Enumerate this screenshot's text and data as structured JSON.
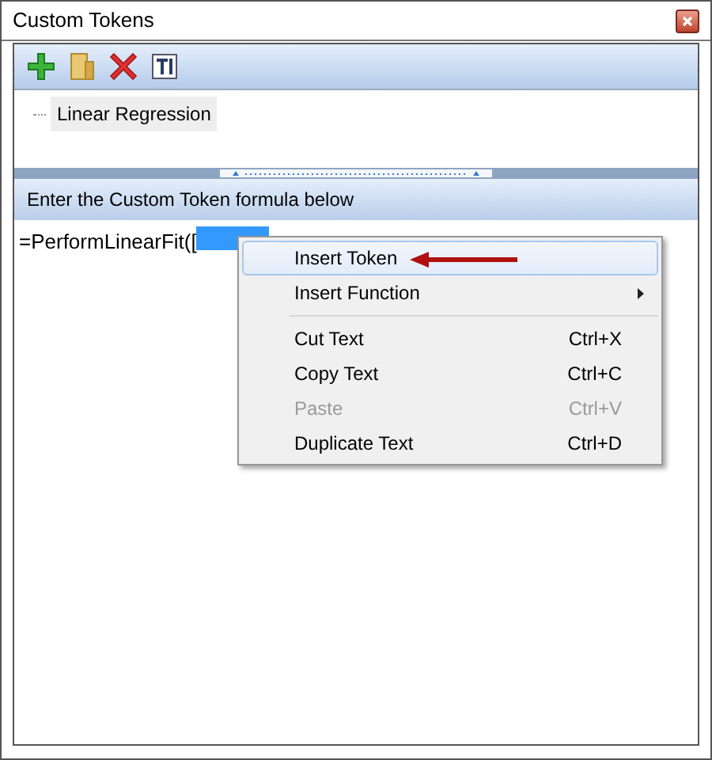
{
  "window": {
    "title": "Custom Tokens"
  },
  "toolbar": {
    "buttons": [
      {
        "kind": "add"
      },
      {
        "kind": "folder"
      },
      {
        "kind": "delete"
      },
      {
        "kind": "text"
      }
    ]
  },
  "tree": {
    "items": [
      {
        "label": "Linear Regression",
        "selected": true
      }
    ]
  },
  "formula_header": "Enter the Custom Token formula below",
  "formula": {
    "text": "=PerformLinearFit([",
    "has_selection": true
  },
  "context_menu": {
    "items": [
      {
        "kind": "item",
        "label": "Insert Token",
        "highlighted": true,
        "disabled": false,
        "arrow_annotation": true
      },
      {
        "kind": "submenu",
        "label": "Insert Function",
        "highlighted": false,
        "disabled": false
      },
      {
        "kind": "separator"
      },
      {
        "kind": "item",
        "label": "Cut Text",
        "shortcut": "Ctrl+X",
        "highlighted": false,
        "disabled": false
      },
      {
        "kind": "item",
        "label": "Copy Text",
        "shortcut": "Ctrl+C",
        "highlighted": false,
        "disabled": false
      },
      {
        "kind": "item",
        "label": "Paste",
        "shortcut": "Ctrl+V",
        "highlighted": false,
        "disabled": true
      },
      {
        "kind": "item",
        "label": "Duplicate Text",
        "shortcut": "Ctrl+D",
        "highlighted": false,
        "disabled": false
      }
    ]
  }
}
